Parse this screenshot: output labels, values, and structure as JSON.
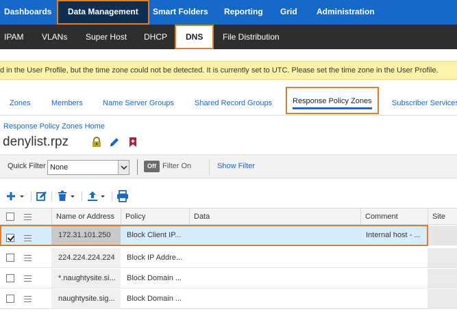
{
  "top_nav": {
    "items": [
      "Dashboards",
      "Data Management",
      "Smart Folders",
      "Reporting",
      "Grid",
      "Administration"
    ],
    "active": "Data Management"
  },
  "sub_nav": {
    "items": [
      "IPAM",
      "VLANs",
      "Super Host",
      "DHCP",
      "DNS",
      "File Distribution"
    ],
    "active": "DNS"
  },
  "warning": {
    "text": "d in the User Profile, but the time zone could not be detected. It is currently set to UTC. Please set the time zone in the User Profile."
  },
  "tabs": {
    "items": [
      "Zones",
      "Members",
      "Name Server Groups",
      "Shared Record Groups",
      "Response Policy Zones",
      "Subscriber Services"
    ],
    "active": "Response Policy Zones"
  },
  "breadcrumb": "Response Policy Zones Home",
  "page_title": "denylist.rpz",
  "title_icons": [
    "lock-icon",
    "pencil-icon",
    "bookmark-plus-icon"
  ],
  "filter": {
    "quick_filter_label": "Quick Filter",
    "quick_filter_value": "None",
    "toggle_label": "Off",
    "filter_on_label": "Filter On",
    "show_filter_label": "Show Filter"
  },
  "toolbar": {
    "icons": [
      "add-icon",
      "edit-icon",
      "delete-icon",
      "export-icon",
      "print-icon"
    ]
  },
  "table": {
    "columns": [
      "Name or Address",
      "Policy",
      "Data",
      "Comment",
      "Site"
    ],
    "rows": [
      {
        "name": "172.31.101.250",
        "policy": "Block Client IP...",
        "data": "",
        "comment": "Internal host - ...",
        "site": "",
        "selected": true
      },
      {
        "name": "224.224.224.224",
        "policy": "Block IP Addre...",
        "data": "",
        "comment": "",
        "site": "",
        "selected": false
      },
      {
        "name": "*.naughtysite.si...",
        "policy": "Block Domain ...",
        "data": "",
        "comment": "",
        "site": "",
        "selected": false
      },
      {
        "name": "naughtysite.sig...",
        "policy": "Block Domain ...",
        "data": "",
        "comment": "",
        "site": "",
        "selected": false
      }
    ]
  },
  "colors": {
    "nav_blue": "#1668c9",
    "nav_dark": "#0e2f52",
    "subnav_bg": "#2e2e2e",
    "highlight_orange": "#e07b2a",
    "warning_bg": "#fbf3a8",
    "selected_row": "#d9ecfb"
  }
}
